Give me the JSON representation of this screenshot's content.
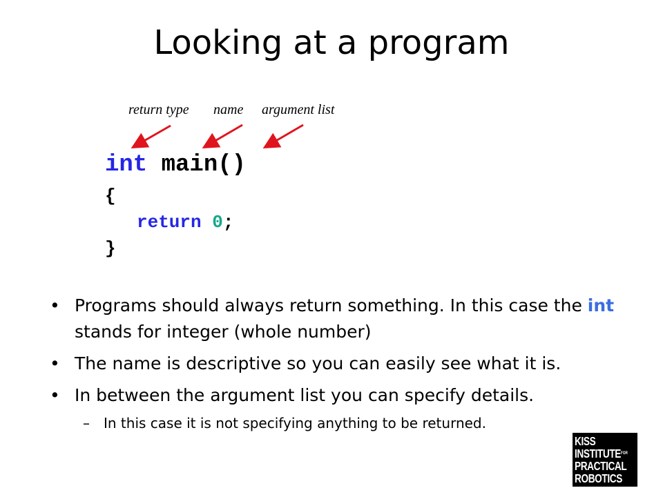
{
  "slide": {
    "title": "Looking at a program"
  },
  "annotations": {
    "return_type": "return type",
    "name": "name",
    "argument_list": "argument list",
    "arrow_color": "#e0141e"
  },
  "code": {
    "keyword_int": "int",
    "function_name": "main()",
    "open_brace": "{",
    "keyword_return": "return",
    "return_value": "0",
    "semicolon": ";",
    "close_brace": "}",
    "keyword_color": "#2626e6",
    "number_color": "#14a88c"
  },
  "bullets": [
    {
      "marker": "•",
      "text_before": "Programs should always return something. In this case the ",
      "highlight": "int",
      "text_after": " stands for integer (whole number)"
    },
    {
      "marker": "•",
      "text": "The name is descriptive so you can easily see what it is."
    },
    {
      "marker": "•",
      "text": "In between the argument list you can specify details."
    }
  ],
  "sub_bullet": {
    "marker": "–",
    "text": "In this case it is not specifying anything to be returned."
  },
  "logo": {
    "line1": "KISS",
    "line2": "INSTITUTE",
    "line2_sup": "FOR",
    "line3": "PRACTICAL",
    "line4": "ROBOTICS"
  }
}
